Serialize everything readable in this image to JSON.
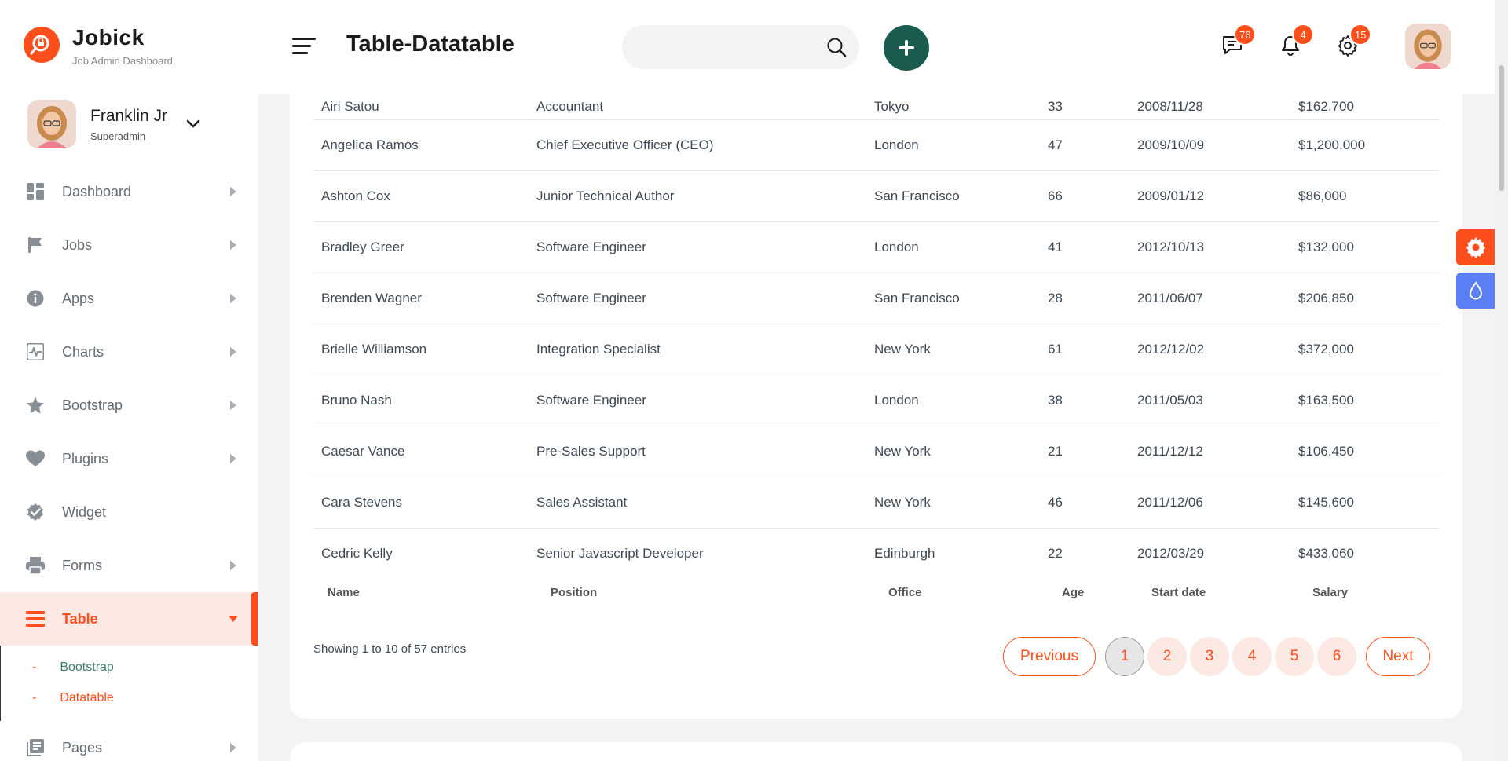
{
  "brand": {
    "name": "Jobick",
    "subtitle": "Job Admin Dashboard"
  },
  "profile": {
    "name": "Franklin Jr",
    "role": "Superadmin"
  },
  "sidebar": {
    "items": [
      {
        "label": "Dashboard",
        "icon": "dashboard-icon"
      },
      {
        "label": "Jobs",
        "icon": "flag-icon"
      },
      {
        "label": "Apps",
        "icon": "info-icon"
      },
      {
        "label": "Charts",
        "icon": "chart-icon"
      },
      {
        "label": "Bootstrap",
        "icon": "star-icon"
      },
      {
        "label": "Plugins",
        "icon": "heart-icon"
      },
      {
        "label": "Widget",
        "icon": "badge-check-icon"
      },
      {
        "label": "Forms",
        "icon": "printer-icon"
      },
      {
        "label": "Table",
        "icon": "table-icon"
      },
      {
        "label": "Pages",
        "icon": "pages-icon"
      }
    ],
    "table_sub": [
      "Bootstrap",
      "Datatable"
    ],
    "sub_dash": "-"
  },
  "header": {
    "title": "Table-Datatable",
    "search_placeholder": "",
    "messages_count": "76",
    "notifications_count": "4",
    "settings_count": "15"
  },
  "table": {
    "partial_row": [
      "Airi Satou",
      "Accountant",
      "Tokyo",
      "33",
      "2008/11/28",
      "$162,700"
    ],
    "rows": [
      [
        "Angelica Ramos",
        "Chief Executive Officer (CEO)",
        "London",
        "47",
        "2009/10/09",
        "$1,200,000"
      ],
      [
        "Ashton Cox",
        "Junior Technical Author",
        "San Francisco",
        "66",
        "2009/01/12",
        "$86,000"
      ],
      [
        "Bradley Greer",
        "Software Engineer",
        "London",
        "41",
        "2012/10/13",
        "$132,000"
      ],
      [
        "Brenden Wagner",
        "Software Engineer",
        "San Francisco",
        "28",
        "2011/06/07",
        "$206,850"
      ],
      [
        "Brielle Williamson",
        "Integration Specialist",
        "New York",
        "61",
        "2012/12/02",
        "$372,000"
      ],
      [
        "Bruno Nash",
        "Software Engineer",
        "London",
        "38",
        "2011/05/03",
        "$163,500"
      ],
      [
        "Caesar Vance",
        "Pre-Sales Support",
        "New York",
        "21",
        "2011/12/12",
        "$106,450"
      ],
      [
        "Cara Stevens",
        "Sales Assistant",
        "New York",
        "46",
        "2011/12/06",
        "$145,600"
      ],
      [
        "Cedric Kelly",
        "Senior Javascript Developer",
        "Edinburgh",
        "22",
        "2012/03/29",
        "$433,060"
      ]
    ],
    "footer_headers": [
      "Name",
      "Position",
      "Office",
      "Age",
      "Start date",
      "Salary"
    ]
  },
  "pagination": {
    "info": "Showing 1 to 10 of 57 entries",
    "previous": "Previous",
    "next": "Next",
    "pages": [
      "1",
      "2",
      "3",
      "4",
      "5",
      "6"
    ],
    "current": "1"
  },
  "colors": {
    "accent": "#fe4e1b",
    "primary_dark": "#1c5b4f",
    "accent_light": "#fde9e3",
    "blue_tab": "#5b7ff5"
  }
}
